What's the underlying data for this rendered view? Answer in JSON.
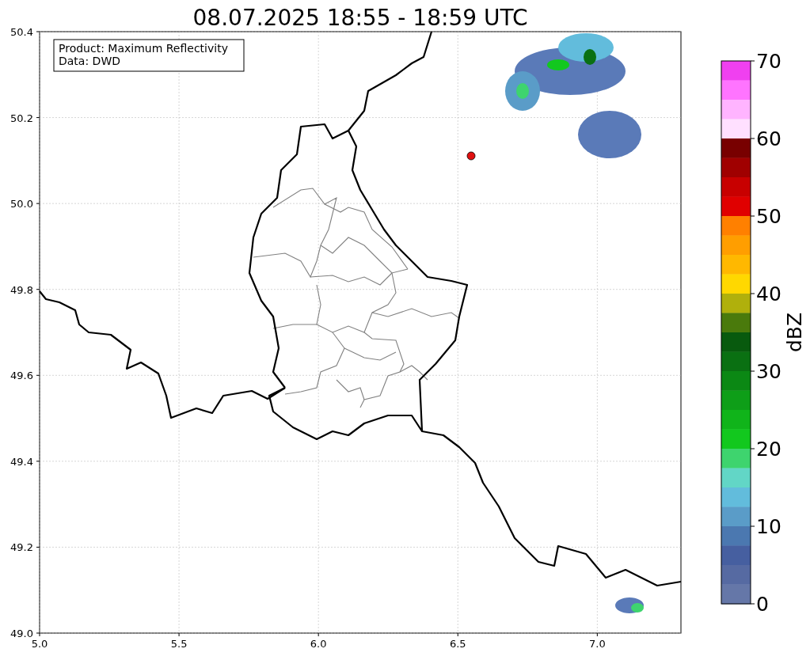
{
  "title": "08.07.2025 18:55 - 18:59 UTC",
  "info_box": [
    "Product: Maximum Reflectivity",
    "Data: DWD"
  ],
  "map": {
    "xticks": [
      "5.0",
      "5.5",
      "6.0",
      "6.5",
      "7.0"
    ],
    "yticks": [
      "50.4",
      "50.2",
      "50.0",
      "49.8",
      "49.6",
      "49.4",
      "49.2",
      "49.0"
    ]
  },
  "colorbar": {
    "label": "dBZ",
    "ticks": [
      "70",
      "60",
      "50",
      "40",
      "30",
      "20",
      "10",
      "0"
    ],
    "segments": [
      {
        "color": "#f040f0"
      },
      {
        "color": "#ff74ff"
      },
      {
        "color": "#ffb4ff"
      },
      {
        "color": "#ffe0ff"
      },
      {
        "color": "#780000"
      },
      {
        "color": "#a00000"
      },
      {
        "color": "#c80000"
      },
      {
        "color": "#e00000"
      },
      {
        "color": "#ff8000"
      },
      {
        "color": "#ff9e00"
      },
      {
        "color": "#ffb800"
      },
      {
        "color": "#ffd800"
      },
      {
        "color": "#b0b00c"
      },
      {
        "color": "#4a7a0c"
      },
      {
        "color": "#085a0e"
      },
      {
        "color": "#0a7012"
      },
      {
        "color": "#0b8814"
      },
      {
        "color": "#0e9e18"
      },
      {
        "color": "#10b41a"
      },
      {
        "color": "#12c81e"
      },
      {
        "color": "#3ed46e"
      },
      {
        "color": "#62d6c6"
      },
      {
        "color": "#62bcdc"
      },
      {
        "color": "#5a9cc8"
      },
      {
        "color": "#4b78b0"
      },
      {
        "color": "#465fa0"
      },
      {
        "color": "#566aa2"
      },
      {
        "color": "#6577a8"
      }
    ]
  }
}
